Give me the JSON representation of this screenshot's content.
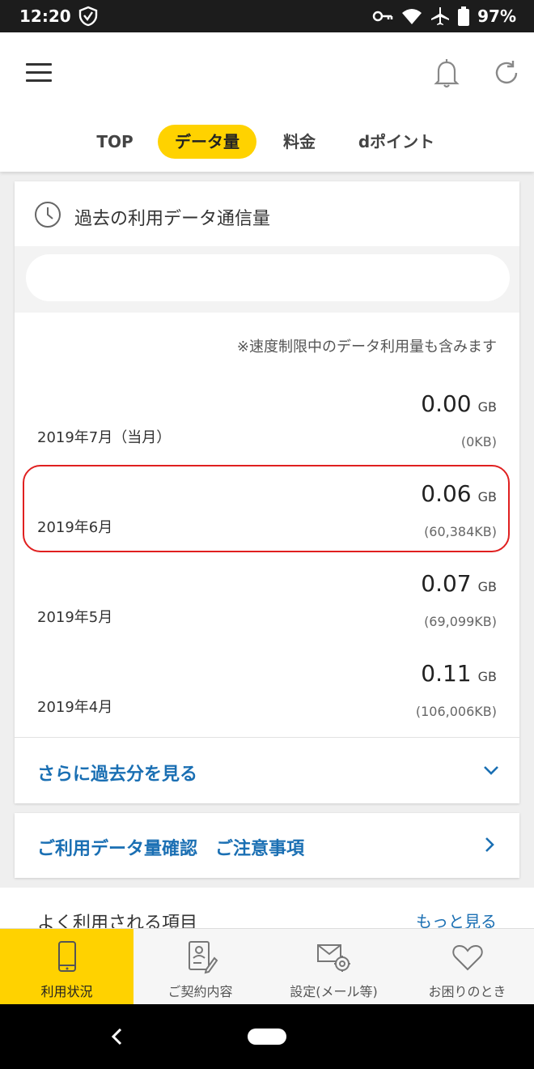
{
  "status_bar": {
    "time": "12:20",
    "battery": "97%",
    "icons": [
      "shield-icon",
      "key-icon",
      "wifi-icon",
      "airplane-icon",
      "battery-icon"
    ]
  },
  "header": {
    "tabs": [
      {
        "label": "TOP",
        "active": false
      },
      {
        "label": "データ量",
        "active": true
      },
      {
        "label": "料金",
        "active": false
      },
      {
        "label": "dポイント",
        "active": false
      }
    ]
  },
  "history": {
    "title": "過去の利用データ通信量",
    "note": "※速度制限中のデータ利用量も含みます",
    "unit": "GB",
    "rows": [
      {
        "month": "2019年7月（当月）",
        "value": "0.00",
        "kb": "(0KB)"
      },
      {
        "month": "2019年6月",
        "value": "0.06",
        "kb": "(60,384KB)"
      },
      {
        "month": "2019年5月",
        "value": "0.07",
        "kb": "(69,099KB)"
      },
      {
        "month": "2019年4月",
        "value": "0.11",
        "kb": "(106,006KB)"
      }
    ],
    "more_label": "さらに過去分を見る"
  },
  "notice": {
    "label": "ご利用データ量確認　ご注意事項"
  },
  "frequent": {
    "title": "よく利用される項目",
    "more": "もっと見る"
  },
  "bottom_nav": [
    {
      "label": "利用状況",
      "icon": "phone-icon",
      "active": true
    },
    {
      "label": "ご契約内容",
      "icon": "contract-icon",
      "active": false
    },
    {
      "label": "設定(メール等)",
      "icon": "mail-settings-icon",
      "active": false
    },
    {
      "label": "お困りのとき",
      "icon": "heart-icon",
      "active": false
    }
  ],
  "colors": {
    "accent": "#ffd200",
    "link": "#1a6fb3",
    "highlight": "#e02020"
  }
}
